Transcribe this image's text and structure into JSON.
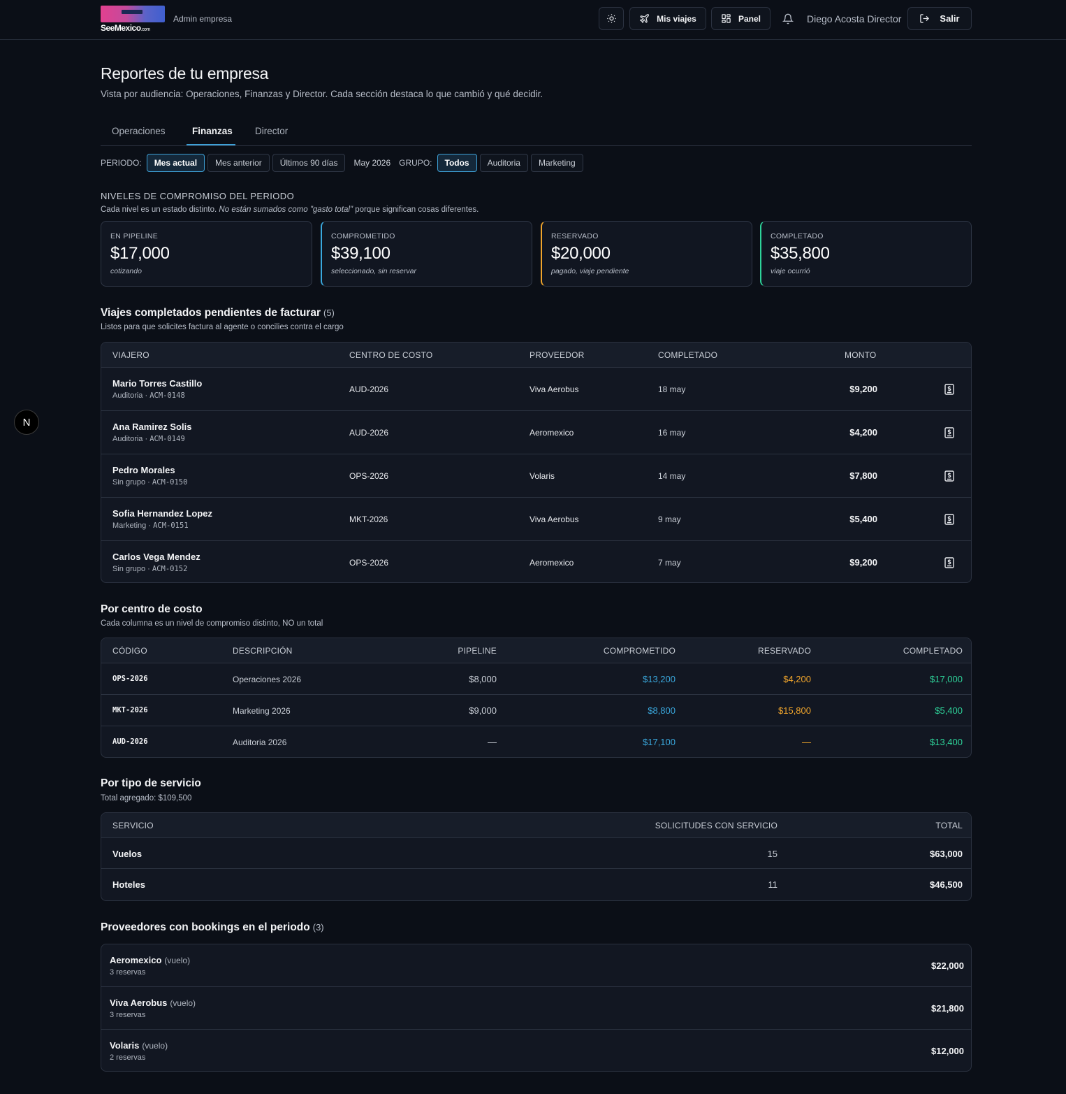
{
  "header": {
    "logo_text": "SeeMexico",
    "logo_suffix": ".com",
    "admin_label": "Admin empresa",
    "theme_icon": "sun-icon",
    "trips_label": "Mis viajes",
    "panel_label": "Panel",
    "user_name": "Diego Acosta Director",
    "logout_label": "Salir"
  },
  "page": {
    "title": "Reportes de tu empresa",
    "subtitle": "Vista por audiencia: Operaciones, Finanzas y Director. Cada sección destaca lo que cambió y qué decidir."
  },
  "tabs": [
    {
      "label": "Operaciones"
    },
    {
      "label": "Finanzas",
      "active": true
    },
    {
      "label": "Director"
    }
  ],
  "filters": {
    "period_label": "PERIODO:",
    "periods": [
      "Mes actual",
      "Mes anterior",
      "Últimos 90 días"
    ],
    "current_month": "May 2026",
    "group_label": "GRUPO:",
    "groups": [
      "Todos",
      "Auditoria",
      "Marketing"
    ]
  },
  "commitment": {
    "title": "NIVELES DE COMPROMISO DEL PERIODO",
    "sub_before": "Cada nivel es un estado distinto. ",
    "sub_em": "No están sumados como \"gasto total\"",
    "sub_after": " porque significan cosas diferentes.",
    "cards": [
      {
        "label": "EN PIPELINE",
        "value": "$17,000",
        "note": "cotizando",
        "color": "#2f3746"
      },
      {
        "label": "COMPROMETIDO",
        "value": "$39,100",
        "note": "seleccionado, sin reservar",
        "color": "#3aa8dd"
      },
      {
        "label": "RESERVADO",
        "value": "$20,000",
        "note": "pagado, viaje pendiente",
        "color": "#f0a52c"
      },
      {
        "label": "COMPLETADO",
        "value": "$35,800",
        "note": "viaje ocurrió",
        "color": "#2ed39a"
      }
    ]
  },
  "pending": {
    "title": "Viajes completados pendientes de facturar",
    "count": "(5)",
    "subtitle": "Listos para que solicites factura al agente o concilies contra el cargo",
    "columns": [
      "VIAJERO",
      "CENTRO DE COSTO",
      "PROVEEDOR",
      "COMPLETADO",
      "MONTO"
    ],
    "rows": [
      {
        "name": "Mario Torres Castillo",
        "group": "Auditoria · ",
        "code": "ACM-0148",
        "center": "AUD-2026",
        "provider": "Viva Aerobus",
        "date": "18 may",
        "amount": "$9,200"
      },
      {
        "name": "Ana Ramirez Solis",
        "group": "Auditoria · ",
        "code": "ACM-0149",
        "center": "AUD-2026",
        "provider": "Aeromexico",
        "date": "16 may",
        "amount": "$4,200"
      },
      {
        "name": "Pedro Morales",
        "group": "Sin grupo · ",
        "code": "ACM-0150",
        "center": "OPS-2026",
        "provider": "Volaris",
        "date": "14 may",
        "amount": "$7,800"
      },
      {
        "name": "Sofia Hernandez Lopez",
        "group": "Marketing · ",
        "code": "ACM-0151",
        "center": "MKT-2026",
        "provider": "Viva Aerobus",
        "date": "9 may",
        "amount": "$5,400"
      },
      {
        "name": "Carlos Vega Mendez",
        "group": "Sin grupo · ",
        "code": "ACM-0152",
        "center": "OPS-2026",
        "provider": "Aeromexico",
        "date": "7 may",
        "amount": "$9,200"
      }
    ]
  },
  "cost_centers": {
    "title": "Por centro de costo",
    "subtitle": "Cada columna es un nivel de compromiso distinto, NO un total",
    "columns": [
      "CÓDIGO",
      "DESCRIPCIÓN",
      "PIPELINE",
      "COMPROMETIDO",
      "RESERVADO",
      "COMPLETADO"
    ],
    "rows": [
      {
        "code": "OPS-2026",
        "desc": "Operaciones 2026",
        "pipeline": "$8,000",
        "committed": "$13,200",
        "reserved": "$4,200",
        "completed": "$17,000"
      },
      {
        "code": "MKT-2026",
        "desc": "Marketing 2026",
        "pipeline": "$9,000",
        "committed": "$8,800",
        "reserved": "$15,800",
        "completed": "$5,400"
      },
      {
        "code": "AUD-2026",
        "desc": "Auditoria 2026",
        "pipeline": "—",
        "committed": "$17,100",
        "reserved": "—",
        "completed": "$13,400"
      }
    ]
  },
  "services": {
    "title": "Por tipo de servicio",
    "subtitle": "Total agregado: $109,500",
    "columns": [
      "SERVICIO",
      "SOLICITUDES CON SERVICIO",
      "TOTAL"
    ],
    "rows": [
      {
        "name": "Vuelos",
        "count": "15",
        "total": "$63,000"
      },
      {
        "name": "Hoteles",
        "count": "11",
        "total": "$46,500"
      }
    ]
  },
  "providers": {
    "title": "Proveedores con bookings en el periodo",
    "count": "(3)",
    "rows": [
      {
        "name": "Aeromexico",
        "type": "(vuelo)",
        "bookings": "3 reservas",
        "total": "$22,000"
      },
      {
        "name": "Viva Aerobus",
        "type": "(vuelo)",
        "bookings": "3 reservas",
        "total": "$21,800"
      },
      {
        "name": "Volaris",
        "type": "(vuelo)",
        "bookings": "2 reservas",
        "total": "$12,000"
      }
    ]
  },
  "dev_badge": "N"
}
